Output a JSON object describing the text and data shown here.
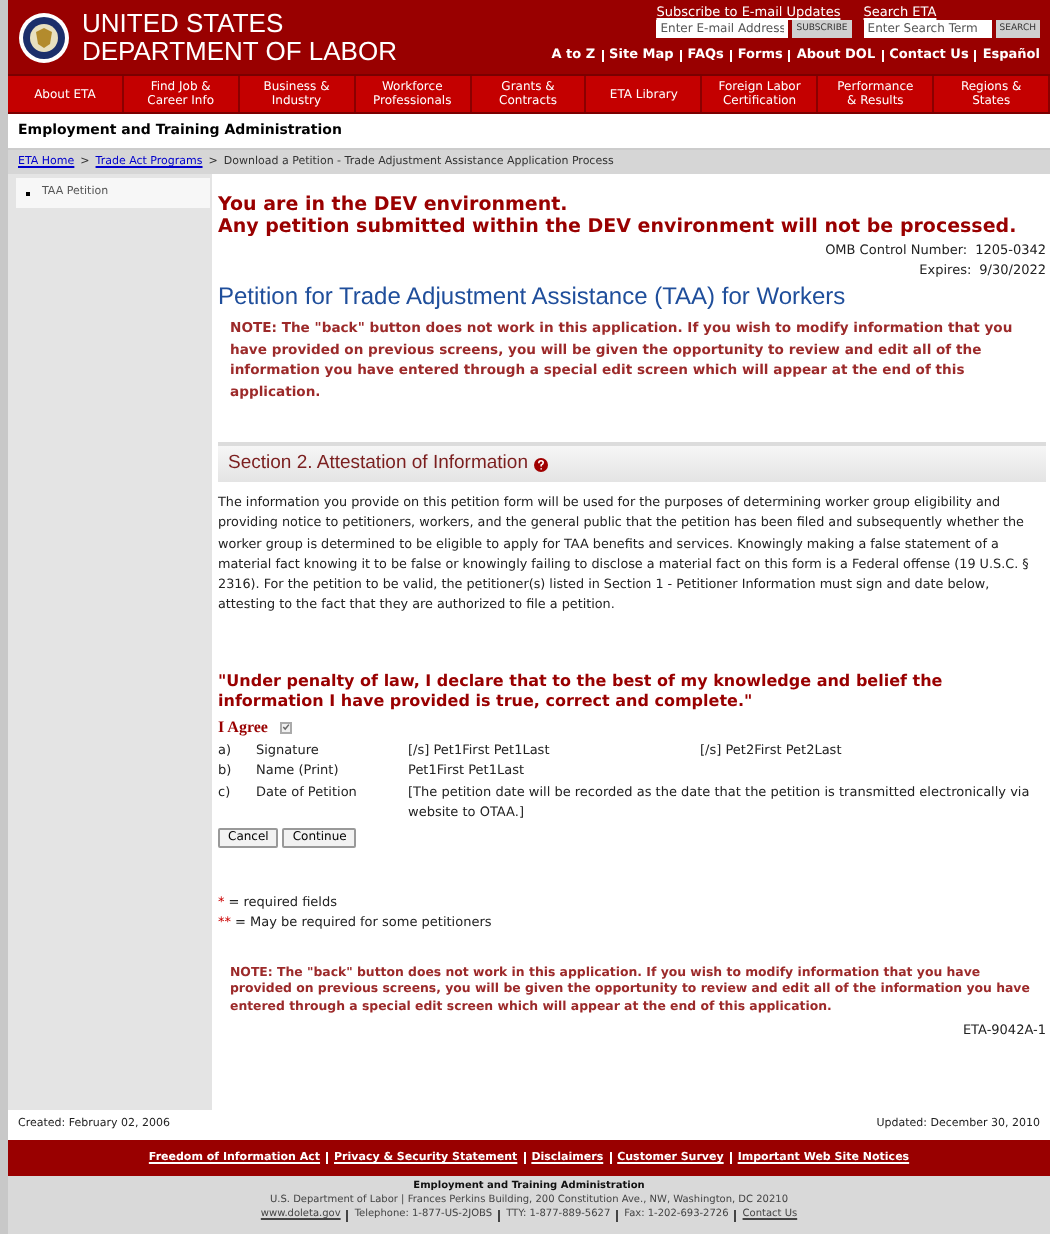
{
  "header": {
    "title_lines": [
      "UNITED STATES",
      "DEPARTMENT OF LABOR"
    ],
    "subscribe": {
      "label": "Subscribe to E-mail Updates",
      "placeholder": "Enter E-mail Address",
      "button": "SUBSCRIBE"
    },
    "search": {
      "label": "Search ETA",
      "placeholder": "Enter Search Term",
      "button": "SEARCH"
    },
    "utility_links": [
      "A to Z",
      "Site Map",
      "FAQs",
      "Forms",
      "About DOL",
      "Contact Us",
      "Español"
    ]
  },
  "nav": [
    {
      "lines": [
        "About ETA"
      ]
    },
    {
      "lines": [
        "Find Job &",
        "Career Info"
      ]
    },
    {
      "lines": [
        "Business &",
        "Industry"
      ]
    },
    {
      "lines": [
        "Workforce",
        "Professionals"
      ]
    },
    {
      "lines": [
        "Grants &",
        "Contracts"
      ]
    },
    {
      "lines": [
        "ETA Library"
      ]
    },
    {
      "lines": [
        "Foreign Labor",
        "Certification"
      ]
    },
    {
      "lines": [
        "Performance",
        "& Results"
      ]
    },
    {
      "lines": [
        "Regions &",
        "States"
      ]
    }
  ],
  "agency": "Employment and Training Administration",
  "breadcrumb_separator": ">",
  "breadcrumb": [
    {
      "label": "ETA Home",
      "link": true
    },
    {
      "label": "Trade Act Programs",
      "link": true
    },
    {
      "label": "Download a Petition - Trade Adjustment Assistance Application Process",
      "link": false
    }
  ],
  "sidebar": {
    "items": [
      {
        "label": "TAA Petition"
      }
    ]
  },
  "content": {
    "dev_notice": [
      "You are in the DEV environment.",
      "Any petition submitted within the DEV environment will not be processed."
    ],
    "omb": [
      {
        "label": "OMB Control Number:",
        "value": "1205-0342"
      },
      {
        "label": "Expires:",
        "value": "9/30/2022"
      }
    ],
    "title": "Petition for Trade Adjustment Assistance (TAA) for Workers",
    "note": "NOTE: The \"back\" button does not work in this application. If you wish to modify information that you have provided on previous screens, you will be given the opportunity to review and edit all of the information you have entered through a special edit screen which will appear at the end of this application.",
    "section_heading": "Section 2. Attestation of Information",
    "paragraph": "The information you provide on this petition form will be used for the purposes of determining worker group eligibility and providing notice to petitioners, workers, and the general public that the petition has been filed and subsequently whether the worker group is determined to be eligible to apply for TAA benefits and services. Knowingly making a false statement of a material fact knowing it to be false or knowingly failing to disclose a material fact on this form is a Federal offense (19 U.S.C. § 2316). For the petition to be valid, the petitioner(s) listed in Section 1 - Petitioner Information must sign and date below, attesting to the fact that they are authorized to file a petition.",
    "declaration": "\"Under penalty of law, I declare that to the best of my knowledge and belief the information I have provided is true, correct and complete.\"",
    "agree": {
      "label": "I Agree",
      "checked": true
    },
    "rows": [
      {
        "letter": "a)",
        "label": "Signature",
        "values": [
          "[/s] Pet1First Pet1Last",
          "[/s] Pet2First Pet2Last"
        ]
      },
      {
        "letter": "b)",
        "label": "Name (Print)",
        "values": [
          "Pet1First Pet1Last"
        ]
      },
      {
        "letter": "c)",
        "label": "Date of Petition",
        "values": [
          "[The petition date will be recorded as the date that the petition is transmitted electronically via website to OTAA.]"
        ]
      }
    ],
    "buttons": [
      "Cancel",
      "Continue"
    ],
    "legend": [
      {
        "mark": "*",
        "text": "= required fields"
      },
      {
        "mark": "**",
        "text": "= May be required for some petitioners"
      }
    ],
    "note_bottom": "NOTE: The \"back\" button does not work in this application. If you wish to modify information that you have provided on previous screens, you will be given the opportunity to review and edit all of the information you have entered through a special edit screen which will appear at the end of this application.",
    "form_id": "ETA-9042A-1"
  },
  "footer": {
    "created": "Created: February 02, 2006",
    "updated": "Updated: December 30, 2010",
    "links": [
      "Freedom of Information Act",
      "Privacy & Security Statement",
      "Disclaimers",
      "Customer Survey",
      "Important Web Site Notices"
    ],
    "org": "Employment and Training Administration",
    "address": "U.S. Department of Labor | Frances Perkins Building, 200 Constitution Ave., NW, Washington, DC 20210",
    "contact": [
      {
        "text": "www.doleta.gov",
        "link": true
      },
      {
        "text": "Telephone: 1-877-US-2JOBS",
        "link": false
      },
      {
        "text": "TTY: 1-877-889-5627",
        "link": false
      },
      {
        "text": "Fax: 1-202-693-2726",
        "link": false
      },
      {
        "text": "Contact Us",
        "link": true
      }
    ]
  }
}
